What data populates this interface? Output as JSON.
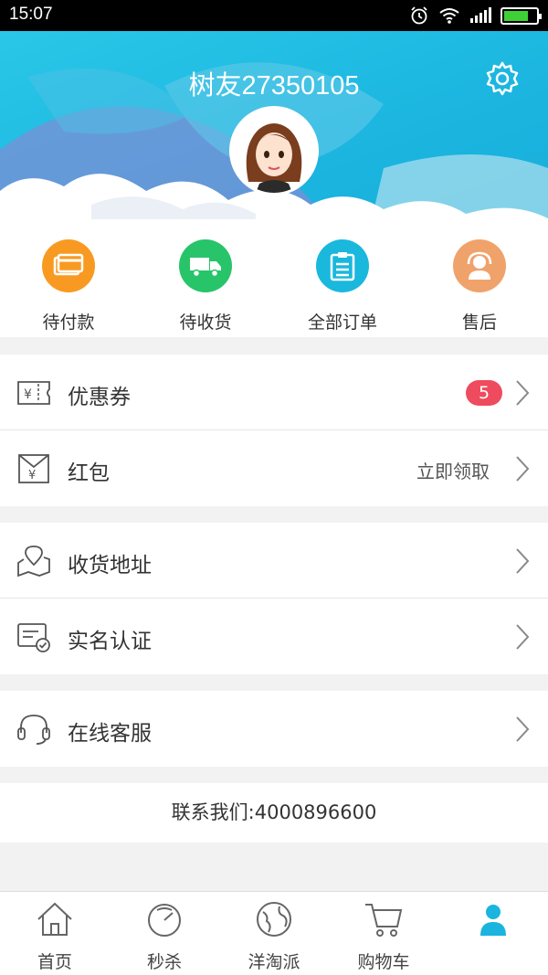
{
  "status_bar": {
    "time": "15:07",
    "battery_level": 0.75
  },
  "header": {
    "username": "树友27350105"
  },
  "orders": [
    {
      "label": "待付款",
      "icon": "card-icon",
      "color": "#f89a22"
    },
    {
      "label": "待收货",
      "icon": "truck-icon",
      "color": "#27c46a"
    },
    {
      "label": "全部订单",
      "icon": "clipboard-icon",
      "color": "#1ab8dd"
    },
    {
      "label": "售后",
      "icon": "support-agent-icon",
      "color": "#f0a26b"
    }
  ],
  "menu": {
    "coupon": {
      "label": "优惠券",
      "badge": "5"
    },
    "red_packet": {
      "label": "红包",
      "action": "立即领取"
    },
    "address": {
      "label": "收货地址"
    },
    "verify": {
      "label": "实名认证"
    },
    "service": {
      "label": "在线客服"
    }
  },
  "contact": "联系我们:4000896600",
  "tabs": [
    {
      "label": "首页",
      "icon": "home-icon"
    },
    {
      "label": "秒杀",
      "icon": "timer-icon"
    },
    {
      "label": "洋淘派",
      "icon": "globe-icon"
    },
    {
      "label": "购物车",
      "icon": "cart-icon"
    },
    {
      "label": "",
      "icon": "user-icon",
      "active": true
    }
  ],
  "colors": {
    "accent": "#1ab4df",
    "badge": "#ef4b5e"
  }
}
